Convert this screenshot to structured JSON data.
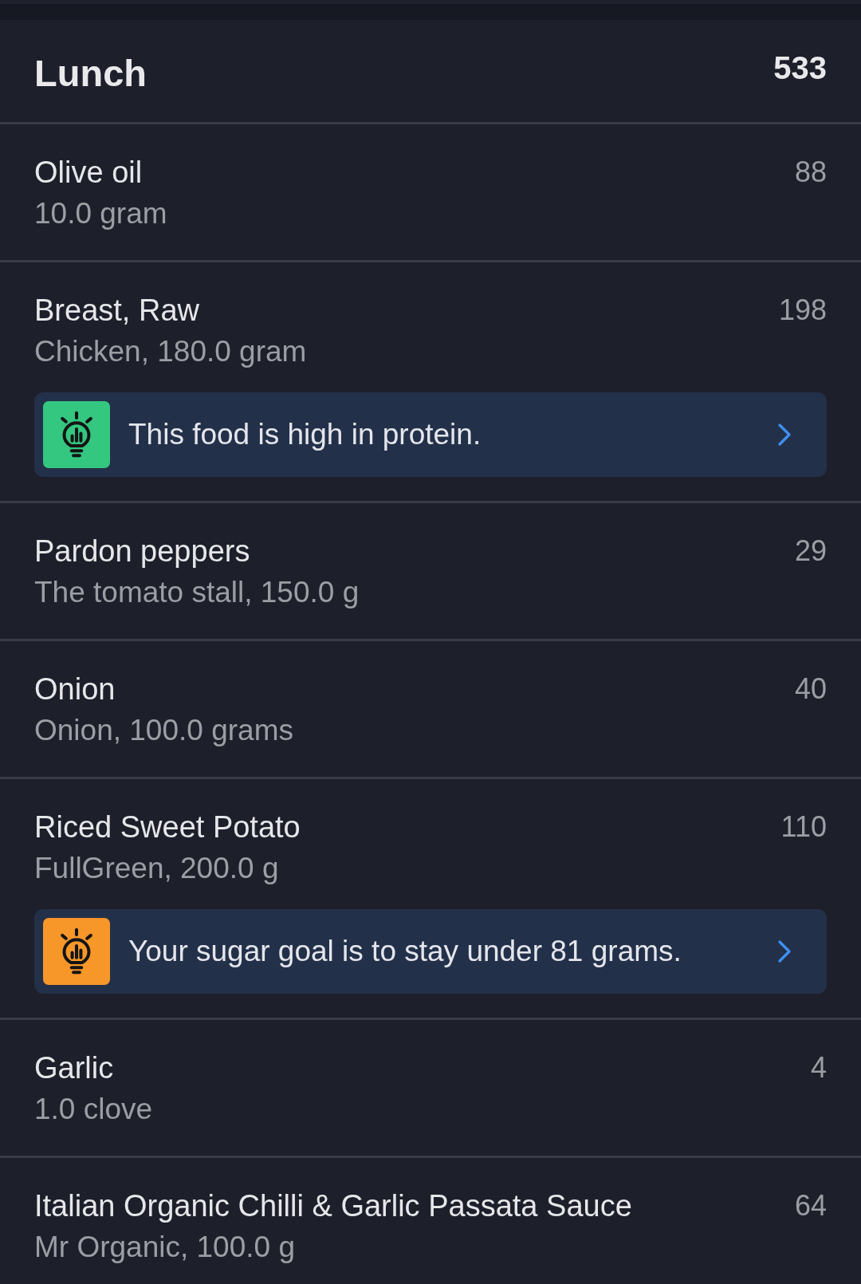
{
  "meal": {
    "title": "Lunch",
    "calories": "533"
  },
  "entries": [
    {
      "name": "Olive oil",
      "detail": "10.0 gram",
      "calories": "88"
    },
    {
      "name": "Breast, Raw",
      "detail": "Chicken, 180.0 gram",
      "calories": "198",
      "tip": {
        "color": "#34c77f",
        "text": "This food is high in protein."
      }
    },
    {
      "name": "Pardon peppers",
      "detail": "The tomato stall, 150.0 g",
      "calories": "29"
    },
    {
      "name": "Onion",
      "detail": "Onion, 100.0 grams",
      "calories": "40"
    },
    {
      "name": "Riced Sweet Potato",
      "detail": "FullGreen, 200.0 g",
      "calories": "110",
      "tip": {
        "color": "#f7972a",
        "text": "Your sugar goal is to stay under 81 grams."
      }
    },
    {
      "name": "Garlic",
      "detail": "1.0 clove",
      "calories": "4"
    },
    {
      "name": "Italian Organic Chilli & Garlic Passata Sauce",
      "detail": "Mr Organic, 100.0 g",
      "calories": "64"
    }
  ]
}
